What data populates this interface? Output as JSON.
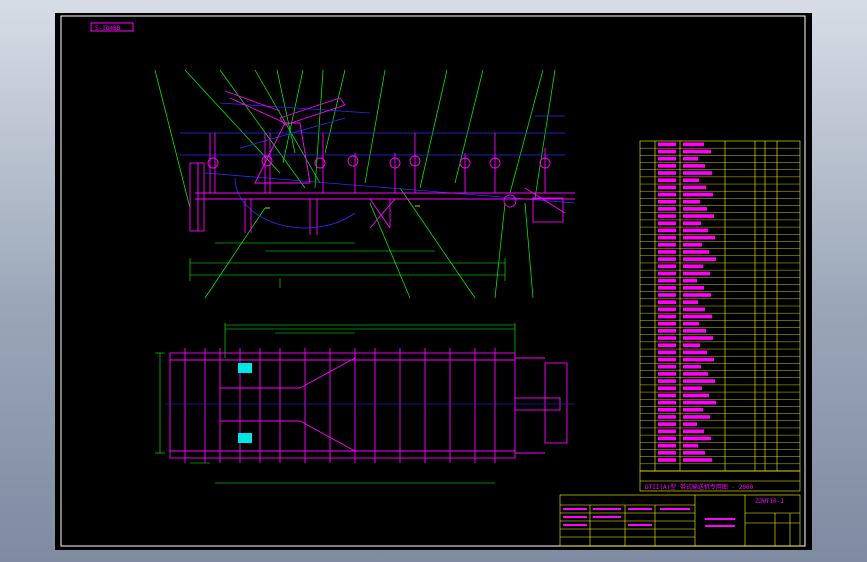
{
  "sheet": {
    "corner_label": "S-ID4BB",
    "drawing_number": "ZJWT10-1",
    "title": "DTII(A)型  带式输送机专用图 - 2000"
  },
  "colors": {
    "background": "#000000",
    "frame": "#ffffff",
    "outline": "#ff00ff",
    "dimension": "#00ff00",
    "centerline": "#0000ff",
    "highlight": "#00ffff",
    "table": "#ffff00"
  }
}
